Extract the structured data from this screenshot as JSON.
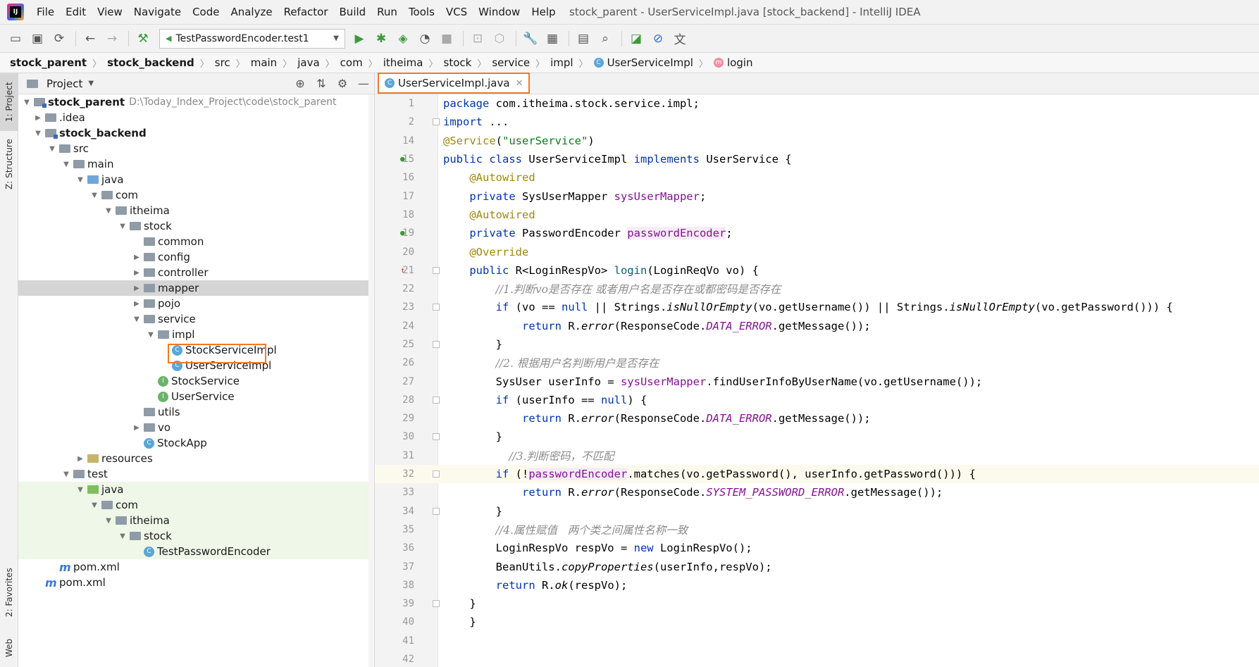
{
  "menu": {
    "items": [
      "File",
      "Edit",
      "View",
      "Navigate",
      "Code",
      "Analyze",
      "Refactor",
      "Build",
      "Run",
      "Tools",
      "VCS",
      "Window",
      "Help"
    ],
    "window_title": "stock_parent - UserServiceImpl.java [stock_backend] - IntelliJ IDEA"
  },
  "toolbar": {
    "run_config": "TestPasswordEncoder.test1",
    "icons": [
      "open-icon",
      "save-icon",
      "sync-icon",
      "back-icon",
      "forward-icon",
      "build-icon",
      "run-icon",
      "debug-icon",
      "coverage-icon",
      "profile-icon",
      "stop-icon",
      "attach-icon",
      "update-icon",
      "settings-icon",
      "structure-icon",
      "terminal-icon",
      "search-icon",
      "stats-icon",
      "disable-icon",
      "translate-icon"
    ]
  },
  "breadcrumb": {
    "items": [
      "stock_parent",
      "stock_backend",
      "src",
      "main",
      "java",
      "com",
      "itheima",
      "stock",
      "service",
      "impl",
      "UserServiceImpl",
      "login"
    ]
  },
  "stripe": {
    "project": "1: Project",
    "structure": "Z: Structure",
    "favorites": "2: Favorites",
    "web": "Web"
  },
  "project_panel": {
    "title": "Project",
    "tree": [
      {
        "label": "stock_parent",
        "hint": "D:\\Today_Index_Project\\code\\stock_parent",
        "bold": true
      },
      {
        "label": ".idea"
      },
      {
        "label": "stock_backend",
        "bold": true
      },
      {
        "label": "src"
      },
      {
        "label": "main"
      },
      {
        "label": "java"
      },
      {
        "label": "com"
      },
      {
        "label": "itheima"
      },
      {
        "label": "stock"
      },
      {
        "label": "common"
      },
      {
        "label": "config"
      },
      {
        "label": "controller"
      },
      {
        "label": "mapper"
      },
      {
        "label": "pojo"
      },
      {
        "label": "service"
      },
      {
        "label": "impl"
      },
      {
        "label": "StockServiceImpl"
      },
      {
        "label": "UserServiceImpl"
      },
      {
        "label": "StockService"
      },
      {
        "label": "UserService"
      },
      {
        "label": "utils"
      },
      {
        "label": "vo"
      },
      {
        "label": "StockApp"
      },
      {
        "label": "resources"
      },
      {
        "label": "test"
      },
      {
        "label": "java"
      },
      {
        "label": "com"
      },
      {
        "label": "itheima"
      },
      {
        "label": "stock"
      },
      {
        "label": "TestPasswordEncoder"
      },
      {
        "label": "pom.xml"
      },
      {
        "label": "pom.xml"
      }
    ]
  },
  "editor": {
    "tab_label": "UserServiceImpl.java",
    "line_numbers": [
      "1",
      "2",
      "14",
      "15",
      "16",
      "17",
      "18",
      "19",
      "20",
      "21",
      "22",
      "23",
      "24",
      "25",
      "26",
      "27",
      "28",
      "29",
      "30",
      "31",
      "32",
      "33",
      "34",
      "35",
      "36",
      "37",
      "38",
      "39",
      "40",
      "41",
      "42"
    ],
    "lines": [
      "package com.itheima.stock.service.impl;",
      "import ...",
      "@Service(\"userService\")",
      "public class UserServiceImpl implements UserService {",
      "    @Autowired",
      "    private SysUserMapper sysUserMapper;",
      "    @Autowired",
      "    private PasswordEncoder passwordEncoder;",
      "    @Override",
      "    public R<LoginRespVo> login(LoginReqVo vo) {",
      "        //1.判断vo是否存在 或者用户名是否存在或都密码是否存在",
      "        if (vo == null || Strings.isNullOrEmpty(vo.getUsername()) || Strings.isNullOrEmpty(vo.getPassword())) {",
      "            return R.error(ResponseCode.DATA_ERROR.getMessage());",
      "        }",
      "        //2. 根据用户名判断用户是否存在",
      "        SysUser userInfo = sysUserMapper.findUserInfoByUserName(vo.getUsername());",
      "        if (userInfo == null) {",
      "            return R.error(ResponseCode.DATA_ERROR.getMessage());",
      "        }",
      "          //3.判断密码，不匹配",
      "        if (!passwordEncoder.matches(vo.getPassword(), userInfo.getPassword())) {",
      "            return R.error(ResponseCode.SYSTEM_PASSWORD_ERROR.getMessage());",
      "        }",
      "        //4.属性赋值   两个类之间属性名称一致",
      "        LoginRespVo respVo = new LoginRespVo();",
      "        BeanUtils.copyProperties(userInfo,respVo);",
      "        return R.ok(respVo);",
      "    }",
      "    }",
      "",
      ""
    ]
  }
}
